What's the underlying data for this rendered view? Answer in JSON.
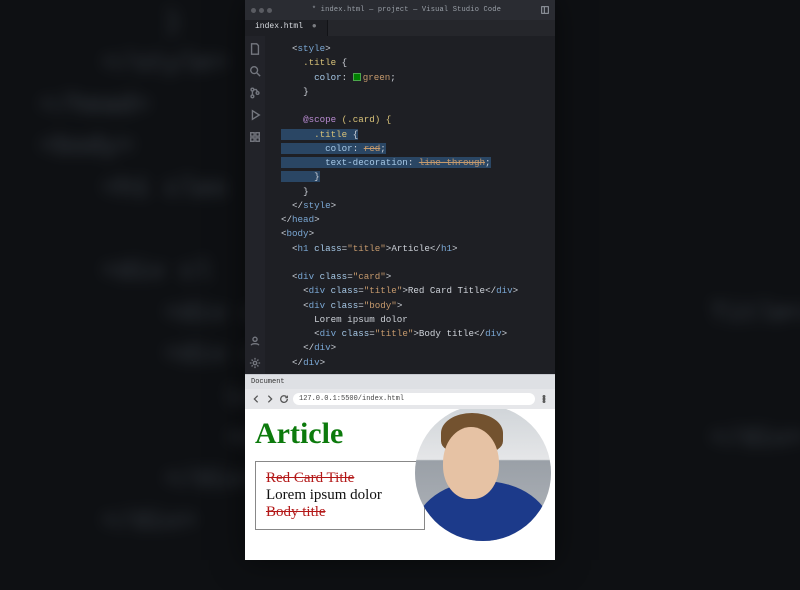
{
  "vscode": {
    "window_title": "* index.html — project — Visual Studio Code",
    "tab_label": "index.html",
    "tab_modified": "●",
    "activity_icons": [
      "files-icon",
      "search-icon",
      "source-control-icon",
      "debug-icon",
      "extensions-icon",
      "account-icon",
      "gear-icon"
    ]
  },
  "code_tokens": {
    "l1a": "<",
    "l1b": "style",
    "l1c": ">",
    "l2a": ".title",
    "l2b": " {",
    "l3a": "color",
    "l3b": ": ",
    "l3c": "green",
    "l3d": ";",
    "l4": "}",
    "l6a": "@scope",
    "l6b": " (.card) {",
    "l7a": ".title",
    "l7b": " {",
    "l8a": "color",
    "l8b": ": ",
    "l8c": "red",
    "l8d": ";",
    "l9a": "text-decoration",
    "l9b": ": ",
    "l9c": "line-through",
    "l9d": ";",
    "l10": "}",
    "l11": "}",
    "l12a": "</",
    "l12b": "style",
    "l12c": ">",
    "l13a": "</",
    "l13b": "head",
    "l13c": ">",
    "l14a": "<",
    "l14b": "body",
    "l14c": ">",
    "l15a": "<",
    "l15b": "h1",
    "l15c": " ",
    "l15d": "class",
    "l15e": "=",
    "l15f": "\"title\"",
    "l15g": ">",
    "l15h": "Article",
    "l15i": "</",
    "l15j": "h1",
    "l15k": ">",
    "l17a": "<",
    "l17b": "div",
    "l17c": " ",
    "l17d": "class",
    "l17e": "=",
    "l17f": "\"card\"",
    "l17g": ">",
    "l18a": "<",
    "l18b": "div",
    "l18c": " ",
    "l18d": "class",
    "l18e": "=",
    "l18f": "\"title\"",
    "l18g": ">",
    "l18h": "Red Card Title",
    "l18i": "</",
    "l18j": "div",
    "l18k": ">",
    "l19a": "<",
    "l19b": "div",
    "l19c": " ",
    "l19d": "class",
    "l19e": "=",
    "l19f": "\"body\"",
    "l19g": ">",
    "l20": "Lorem ipsum dolor",
    "l21a": "<",
    "l21b": "div",
    "l21c": " ",
    "l21d": "class",
    "l21e": "=",
    "l21f": "\"title\"",
    "l21g": ">",
    "l21h": "Body title",
    "l21i": "</",
    "l21j": "div",
    "l21k": ">",
    "l22a": "</",
    "l22b": "div",
    "l22c": ">",
    "l23a": "</",
    "l23b": "div",
    "l23c": ">"
  },
  "background_code": {
    "l1": "        }",
    "l2": "    </style>",
    "l3": "</head>",
    "l4": "<body>",
    "l5": "    <h1 clas",
    "l6": "",
    "l7": "    <div cl",
    "l8": "        <div c                             Title</div>",
    "l9": "        <div c",
    "l10": "            Lore",
    "l11": "            <div                           </div>",
    "l12": "        </div>",
    "l13": "    </div>"
  },
  "browser": {
    "tab_title": "Document",
    "address": "127.0.0.1:5500/index.html",
    "page": {
      "heading": "Article",
      "card": {
        "title": "Red Card Title",
        "body_text": "Lorem ipsum dolor",
        "body_title": "Body title"
      }
    }
  },
  "colors": {
    "editor_bg": "#1e1f24",
    "selection": "#2a4664",
    "green": "#0c7a0c",
    "red": "#b31818"
  }
}
